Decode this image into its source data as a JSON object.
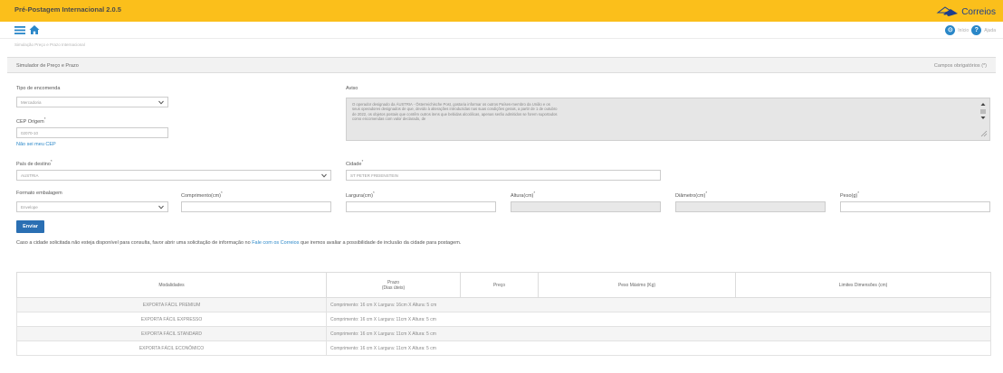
{
  "header": {
    "app_title": "Pré-Postagem Internacional 2.0.5",
    "brand": "Correios",
    "help_left_label": "Início",
    "help_right_label": "Ajuda"
  },
  "breadcrumb": "Simulação Preço e Prazo Internacional",
  "panel": {
    "title": "Simulador de Preço e Prazo",
    "required_note": "Campos obrigatórios (*)"
  },
  "form": {
    "tipo_encomenda": {
      "label": "Tipo de encomenda",
      "value": "Mercadoria"
    },
    "cep_origem": {
      "label": "CEP Origem",
      "value": "02070-10"
    },
    "nao_sei_cep": "Não sei meu CEP",
    "aviso": {
      "label": "Aviso",
      "text": "O operador designado da ÁUSTRIA - Österreichische Post, gostaria informar os outros Países-membro da União e os seus operadores designados de que, devido à alterações introduzidas nas suas condições gerais, a partir de 1 de outubro de 2022, os objetos postais que contêm outros itens que bebidas alcoólicas, apenas serão admitidos se forem suportados como encomendas com valor declarado, de"
    },
    "pais_destino": {
      "label": "País de destino",
      "value": "AUSTRIA"
    },
    "cidade": {
      "label": "Cidade",
      "value": "ST PETER FREIENSTEIN"
    },
    "formato": {
      "label": "Formato embalagem",
      "value": "Envelope"
    },
    "comprimento": {
      "label": "Comprimento(cm)",
      "value": ""
    },
    "largura": {
      "label": "Largura(cm)",
      "value": ""
    },
    "altura": {
      "label": "Altura(cm)",
      "value": ""
    },
    "diametro": {
      "label": "Diâmetro(cm)",
      "value": ""
    },
    "peso": {
      "label": "Peso(g)",
      "value": ""
    }
  },
  "enviar_label": "Enviar",
  "info": {
    "before": "Caso a cidade solicitada não esteja disponível para consulta, favor abrir uma solicitação de informação no",
    "link": "Fale com os Correios",
    "after": "que iremos avaliar a possibilidade de inclusão da cidade para postagem."
  },
  "table": {
    "headers": {
      "modalidades": "Modalidades",
      "prazo_line1": "Prazo",
      "prazo_line2": "(Dias úteis)",
      "preco": "Preço",
      "peso_maximo": "Peso Máximo (Kg)",
      "limites": "Limites Dimensões (cm)"
    },
    "rows": [
      {
        "modalidade": "EXPORTA FÁCIL PREMIUM",
        "prazo": "Comprimento: 16 cm X Largura: 16cm X Altura: 5 cm"
      },
      {
        "modalidade": "EXPORTA FÁCIL EXPRESSO",
        "prazo": "Comprimento: 16 cm X Largura: 11cm X Altura: 5 cm"
      },
      {
        "modalidade": "EXPORTA FÁCIL STANDARD",
        "prazo": "Comprimento: 16 cm X Largura: 11cm X Altura: 5 cm"
      },
      {
        "modalidade": "EXPORTA FÁCIL ECONÔMICO",
        "prazo": "Comprimento: 16 cm X Largura: 11cm X Altura: 5 cm"
      }
    ]
  },
  "colors": {
    "topbar": "#fbbf1b",
    "brand_blue": "#1c3e8c",
    "accent_blue": "#2a87c8",
    "button_blue": "#2a6fb3"
  }
}
